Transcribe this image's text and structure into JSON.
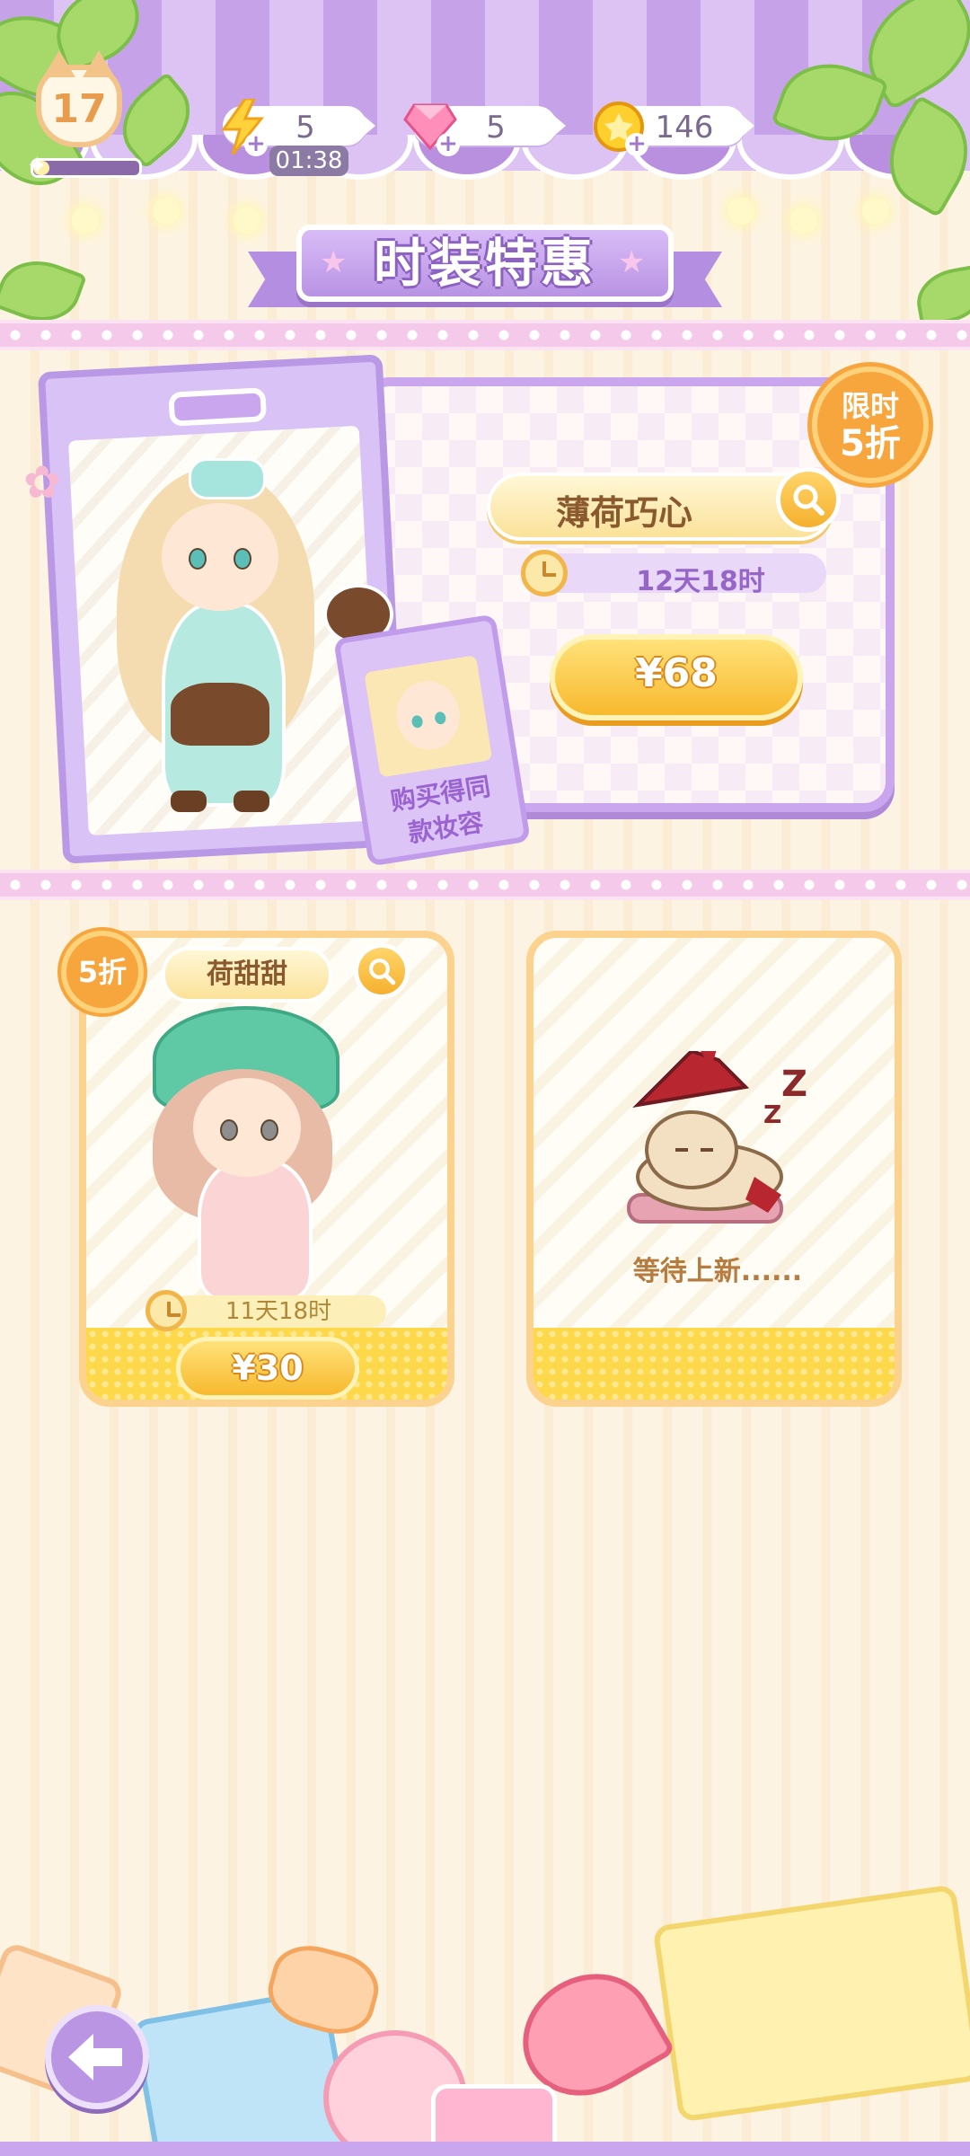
{
  "hud": {
    "level": "17",
    "xp_progress": 0.15,
    "energy": {
      "value": "5",
      "timer": "01:38"
    },
    "gems": {
      "value": "5"
    },
    "coins": {
      "value": "146"
    }
  },
  "banner": {
    "title": "时装特惠"
  },
  "featured": {
    "badge_line1": "限时",
    "badge_line2": "5折",
    "name": "薄荷巧心",
    "time_left": "12天18时",
    "price": "¥68",
    "makeup_tag_line1": "购买得同",
    "makeup_tag_line2": "款妆容"
  },
  "cards": [
    {
      "badge": "5折",
      "name": "荷甜甜",
      "time_left": "11天18时",
      "price": "¥30"
    },
    {
      "waiting_text": "等待上新......"
    }
  ],
  "colors": {
    "accent_purple": "#c9a6ee",
    "gold": "#f7b92e",
    "orange_badge": "#f7a63d"
  },
  "icons": [
    "lightning-icon",
    "gem-icon",
    "coin-icon",
    "search-icon",
    "clock-icon",
    "back-arrow-icon",
    "sleeping-cat-icon"
  ]
}
